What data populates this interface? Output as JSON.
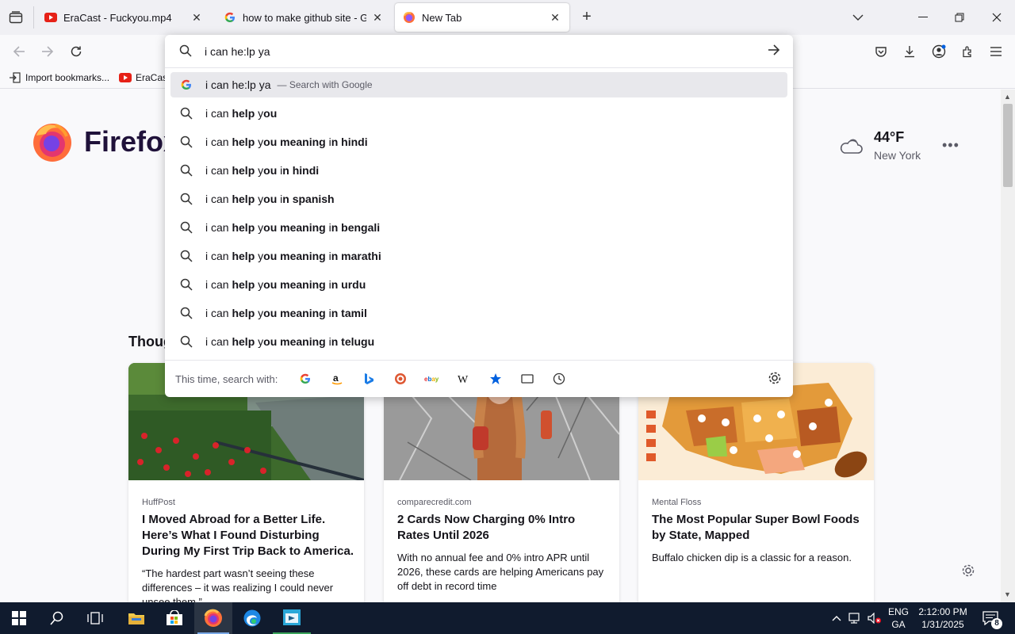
{
  "tabs": [
    {
      "title": "EraCast - Fuckyou.mp4",
      "icon": "youtube-icon"
    },
    {
      "title": "how to make github site - Goog",
      "icon": "google-icon"
    },
    {
      "title": "New Tab",
      "icon": "firefox-icon"
    }
  ],
  "bookmarks": [
    {
      "label": "Import bookmarks...",
      "icon": "import-icon"
    },
    {
      "label": "EraCast",
      "icon": "youtube-icon"
    }
  ],
  "urlbar": {
    "value": "i can he:lp ya",
    "first_suggestion": {
      "text": "i can he:lp ya",
      "action": "— Search with Google"
    },
    "suggestions": [
      {
        "prefix": "i can ",
        "bold": "help ",
        "mid": "y",
        "bold2": "ou",
        "suffix_plain": "",
        "suffix_bold": ""
      },
      {
        "prefix": "i can ",
        "bold": "help ",
        "mid": "y",
        "bold2": "ou meaning ",
        "suffix_plain": "i",
        "suffix_bold": "n hindi"
      },
      {
        "prefix": "i can ",
        "bold": "help ",
        "mid": "y",
        "bold2": "ou ",
        "suffix_plain": "i",
        "suffix_bold": "n hindi"
      },
      {
        "prefix": "i can ",
        "bold": "help ",
        "mid": "y",
        "bold2": "ou ",
        "suffix_plain": "i",
        "suffix_bold": "n spanish"
      },
      {
        "prefix": "i can ",
        "bold": "help ",
        "mid": "y",
        "bold2": "ou meaning ",
        "suffix_plain": "i",
        "suffix_bold": "n bengali"
      },
      {
        "prefix": "i can ",
        "bold": "help ",
        "mid": "y",
        "bold2": "ou meaning ",
        "suffix_plain": "i",
        "suffix_bold": "n marathi"
      },
      {
        "prefix": "i can ",
        "bold": "help ",
        "mid": "y",
        "bold2": "ou meaning ",
        "suffix_plain": "i",
        "suffix_bold": "n urdu"
      },
      {
        "prefix": "i can ",
        "bold": "help ",
        "mid": "y",
        "bold2": "ou meaning ",
        "suffix_plain": "i",
        "suffix_bold": "n tamil"
      },
      {
        "prefix": "i can ",
        "bold": "help ",
        "mid": "y",
        "bold2": "ou meaning ",
        "suffix_plain": "i",
        "suffix_bold": "n telugu"
      }
    ],
    "search_with_label": "This time, search with:",
    "engines": [
      "google-icon",
      "amazon-icon",
      "bing-icon",
      "duckduckgo-icon",
      "ebay-icon",
      "wikipedia-icon",
      "bookmarks-icon",
      "tabs-icon",
      "history-icon"
    ]
  },
  "newtab": {
    "logo_text": "Firefox",
    "weather": {
      "temp": "44°F",
      "city": "New York"
    },
    "section_title": "Thoug",
    "cards": [
      {
        "source": "HuffPost",
        "headline": "I Moved Abroad for a Better Life. Here’s What I Found Disturbing During My First Trip Back to America.",
        "desc": "“The hardest part wasn’t seeing these differences – it was realizing I could never unsee them.”"
      },
      {
        "source": "comparecredit.com",
        "headline": "2 Cards Now Charging 0% Intro Rates Until 2026",
        "desc": "With no annual fee and 0% intro APR until 2026, these cards are helping Americans pay off debt in record time"
      },
      {
        "source": "Mental Floss",
        "headline": "The Most Popular Super Bowl Foods by State, Mapped",
        "desc": "Buffalo chicken dip is a classic for a reason."
      }
    ]
  },
  "taskbar": {
    "lang": "ENG",
    "lang2": "GA",
    "time": "2:12:00 PM",
    "date": "1/31/2025",
    "notif_count": "8"
  }
}
